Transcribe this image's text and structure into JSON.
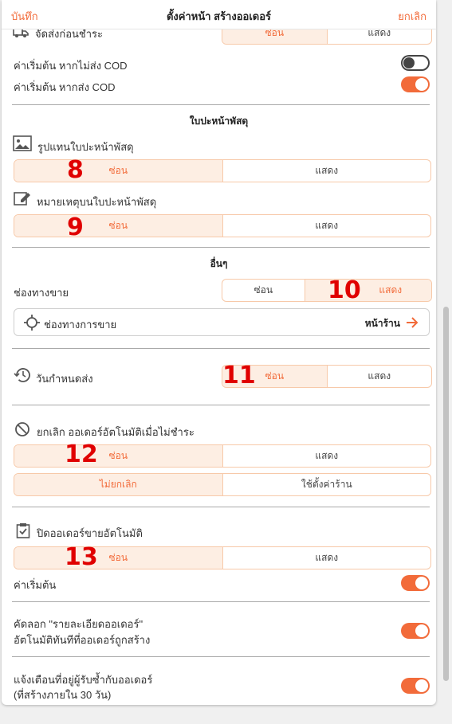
{
  "header": {
    "save_label": "บันทึก",
    "title": "ตั้งค่าหน้า สร้างออเดอร์",
    "cancel_label": "ยกเลิก"
  },
  "rows": {
    "partial_top_label": "จัดส่งก่อนชำระ",
    "partial_top_hide": "ซ่อน",
    "partial_top_show": "แสดง",
    "cod_off_label": "ค่าเริ่มต้น หากไม่ส่ง COD",
    "cod_on_label": "ค่าเริ่มต้น หากส่ง COD"
  },
  "label_section": {
    "title": "ใบปะหน้าพัสดุ",
    "image_label": "รูปแทนใบปะหน้าพัสดุ",
    "note_label": "หมายเหตุบนใบปะหน้าพัสดุ",
    "hide": "ซ่อน",
    "show": "แสดง"
  },
  "other_section": {
    "title": "อื่นๆ",
    "channel_label": "ช่องทางขาย",
    "channel_box_label": "ช่องทางการขาย",
    "channel_box_value": "หน้าร้าน",
    "due_date_label": "วันกำหนดส่ง",
    "auto_cancel_label": "ยกเลิก ออเดอร์อัตโนมัติเมื่อไม่ชำระ",
    "no_cancel": "ไม่ยกเลิก",
    "use_store_setting": "ใช้ตั้งค่าร้าน",
    "auto_close_label": "ปิดออเดอร์ขายอัตโนมัติ",
    "default_label": "ค่าเริ่มต้น",
    "copy_label_line1": "คัดลอก \"รายละเอียดออเดอร์\"",
    "copy_label_line2": "อัตโนมัติทันทีที่ออเดอร์ถูกสร้าง",
    "dup_label_line1": "แจ้งเตือนที่อยู่ผู้รับซ้ำกับออเดอร์",
    "dup_label_line2": "(ที่สร้างภายใน 30 วัน)",
    "hide": "ซ่อน",
    "show": "แสดง"
  },
  "markers": {
    "m8": "8",
    "m9": "9",
    "m10": "10",
    "m11": "11",
    "m12": "12",
    "m13": "13"
  },
  "toggles": {
    "cod_off": false,
    "cod_on": true,
    "default": true,
    "copy_details": true,
    "dup_alert": true
  },
  "colors": {
    "accent": "#f26b3a",
    "accent_light": "#fdeee3",
    "marker_red": "#e00000"
  }
}
